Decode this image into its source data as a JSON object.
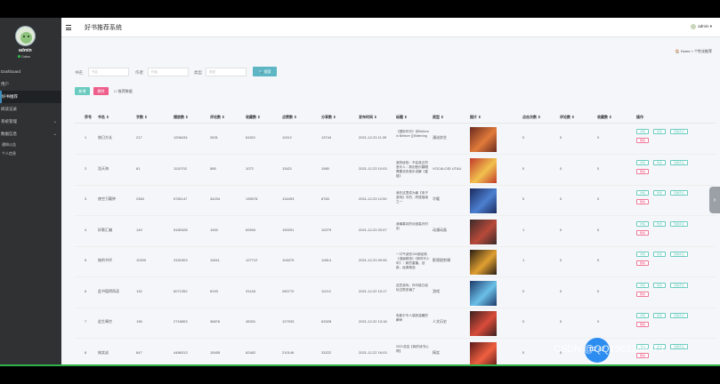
{
  "sidebar": {
    "user": {
      "name": "admin",
      "status": "Online"
    },
    "items": [
      {
        "label": "Dashboard",
        "active": false,
        "sub": false
      },
      {
        "label": "用户",
        "active": false,
        "sub": false
      },
      {
        "label": "好书推荐",
        "active": true,
        "sub": false
      },
      {
        "label": "阅读记录",
        "active": false,
        "sub": false
      },
      {
        "label": "系统管理",
        "active": false,
        "sub": false,
        "chevron": "⌄"
      },
      {
        "label": "数据信息",
        "active": false,
        "sub": false,
        "chevron": "⌄"
      },
      {
        "label": "通知公告",
        "active": false,
        "sub": true
      },
      {
        "label": "个人信息",
        "active": false,
        "sub": true
      }
    ]
  },
  "topbar": {
    "title": "好书推荐系统",
    "user": "admin"
  },
  "breadcrumb": "🏠 Home  >  个性化推荐",
  "filters": {
    "f1_label": "书名",
    "f1_placeholder": "书名",
    "f2_label": "作者",
    "f2_placeholder": "作者",
    "f3_label": "类型",
    "f3_placeholder": "类型",
    "search": "🔍 搜索"
  },
  "actions": {
    "add": "新增",
    "delete": "删除",
    "record": "☐ 推荐数据"
  },
  "table": {
    "headers": [
      "序号",
      "书名 ⇕",
      "字数 ⇕",
      "播放数 ⇕",
      "评论数 ⇕",
      "收藏数 ⇕",
      "点赞数 ⇕",
      "分享数 ⇕",
      "发布时间 ⇕",
      "标题 ⇕",
      "类型 ⇕",
      "图片 ⇕",
      "点击次数 ⇕",
      "评论数 ⇕",
      "收藏数 ⇕",
      "操作"
    ],
    "rows": [
      {
        "n": "1",
        "name": "她日方长",
        "c1": "217",
        "c2": "1206434",
        "c3": "2631",
        "c4": "61521",
        "c5": "11912",
        "c6": "13744",
        "date": "2021-12-23 11:39",
        "title": "《国际时代》评Believe in Believe 让Believing",
        "type": "漫谈综艺",
        "v1": "0",
        "v2": "0",
        "v3": "0"
      },
      {
        "n": "2",
        "name": "浩天海",
        "c1": "61",
        "c2": "1110702",
        "c3": "585",
        "c4": "1072",
        "c5": "13421",
        "c6": "1980",
        "date": "2021-12-23 10:03",
        "title": "我的经验：不会真正的音乐人｜原创音乐翻唱需要流传音乐讲解《星链》",
        "type": "VOCALOID UTAU",
        "v1": "0",
        "v2": "0",
        "v3": "0"
      },
      {
        "n": "3",
        "name": "夜空万籁钟",
        "c1": "2363",
        "c2": "6781147",
        "c3": "34234",
        "c4": "135978",
        "c5": "134493",
        "c6": "8783",
        "date": "2021-12-23 12:50",
        "title": "我在这里成为最【电子游戏】中的，终极指南之一",
        "type": "冷暖",
        "v1": "0",
        "v2": "0",
        "v3": "0"
      },
      {
        "n": "4",
        "name": "好歌汇编",
        "c1": "149",
        "c2": "5180328",
        "c3": "1452",
        "c4": "62694",
        "c5": "190291",
        "c6": "10279",
        "date": "2021-12-23 20:07",
        "title": "我最喜欢的动漫高光时刻",
        "type": "动漫动画",
        "v1": "1",
        "v2": "0",
        "v3": "0"
      },
      {
        "n": "5",
        "name": "她的书评",
        "c1": "10200",
        "c2": "3152303",
        "c3": "11541",
        "c4": "127712",
        "c5": "104079",
        "c6": "10814",
        "date": "2021-12-23 09:06",
        "title": "一口气读完100部经典《漫画精选》《新时代少年》｜新的重播，创新，经典精选",
        "type": "影视剧剪辑",
        "v1": "1",
        "v2": "0",
        "v3": "0"
      },
      {
        "n": "6",
        "name": "此书值得再读",
        "c1": "132",
        "c2": "6071352",
        "c3": "8193",
        "c4": "31148",
        "c5": "260770",
        "c6": "11212",
        "date": "2021-12-22 19:17",
        "title": "这些游戏，你可能已经玩过很多遍了",
        "type": "游戏",
        "v1": "0",
        "v2": "0",
        "v3": "0"
      },
      {
        "n": "7",
        "name": "此生晴空",
        "c1": "136",
        "c2": "2716803",
        "c3": "36876",
        "c4": "45331",
        "c5": "127933",
        "c6": "63328",
        "date": "2021-12-22 13:18",
        "title": "电影中令人感到温暖的瞬间",
        "type": "人文历史",
        "v1": "0",
        "v2": "0",
        "v3": "0"
      },
      {
        "n": "8",
        "name": "她笑谈",
        "c1": "847",
        "c2": "4486313",
        "c3": "15455",
        "c4": "62462",
        "c5": "210146",
        "c6": "33222",
        "date": "2021-12-22 16:03",
        "title": "2021总结【我的读书心得】",
        "type": "搞笑",
        "v1": "0",
        "v2": "0",
        "v3": "0"
      }
    ],
    "op_detail": "详情",
    "op_edit": "修改",
    "op_view": "查看评论",
    "op_delete": "删除"
  },
  "overlay": {
    "timer": "02:42",
    "watermark": "CSDN @QQ1963288475"
  },
  "colors": {
    "sidebar": "#2f3133",
    "accent": "#6bcbc0",
    "danger": "#ee5d8b",
    "search": "#5eb6c4"
  }
}
